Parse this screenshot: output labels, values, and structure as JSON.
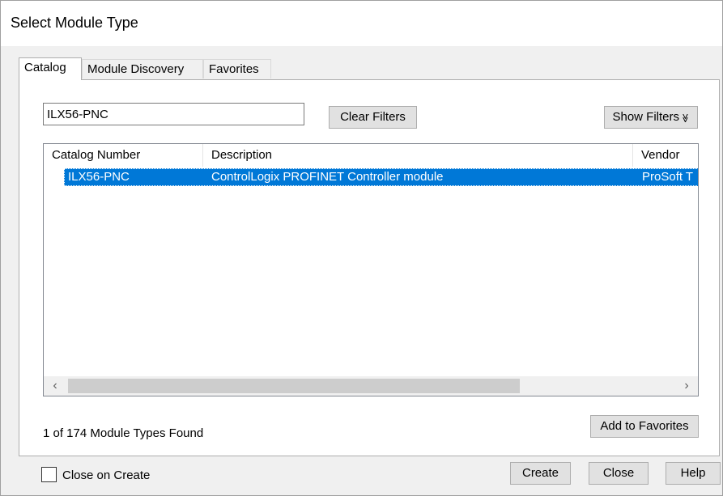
{
  "window": {
    "title": "Select Module Type"
  },
  "tabs": [
    {
      "label": "Catalog",
      "active": true
    },
    {
      "label": "Module Discovery",
      "active": false
    },
    {
      "label": "Favorites",
      "active": false
    }
  ],
  "search": {
    "value": "ILX56-PNC"
  },
  "buttons": {
    "clear_filters": "Clear Filters",
    "show_filters": "Show Filters",
    "show_filters_icon": "≫",
    "add_to_favorites": "Add to Favorites",
    "create": "Create",
    "close": "Close",
    "help": "Help"
  },
  "table": {
    "columns": [
      "Catalog Number",
      "Description",
      "Vendor"
    ],
    "rows": [
      {
        "catalog_number": "ILX56-PNC",
        "description": "ControlLogix PROFINET Controller module",
        "vendor": "ProSoft T",
        "selected": true
      }
    ],
    "scroll_left_icon": "‹",
    "scroll_right_icon": "›"
  },
  "status": {
    "text": "1 of 174 Module Types Found"
  },
  "close_on_create": {
    "label": "Close on Create",
    "checked": false
  },
  "colors": {
    "selection": "#0078d7",
    "button": "#e1e1e1",
    "dialog": "#f0f0f0"
  },
  "icons": {
    "scroll_left": "chevron-left-icon",
    "scroll_right": "chevron-right-icon",
    "show_filters": "double-chevron-down-icon"
  }
}
